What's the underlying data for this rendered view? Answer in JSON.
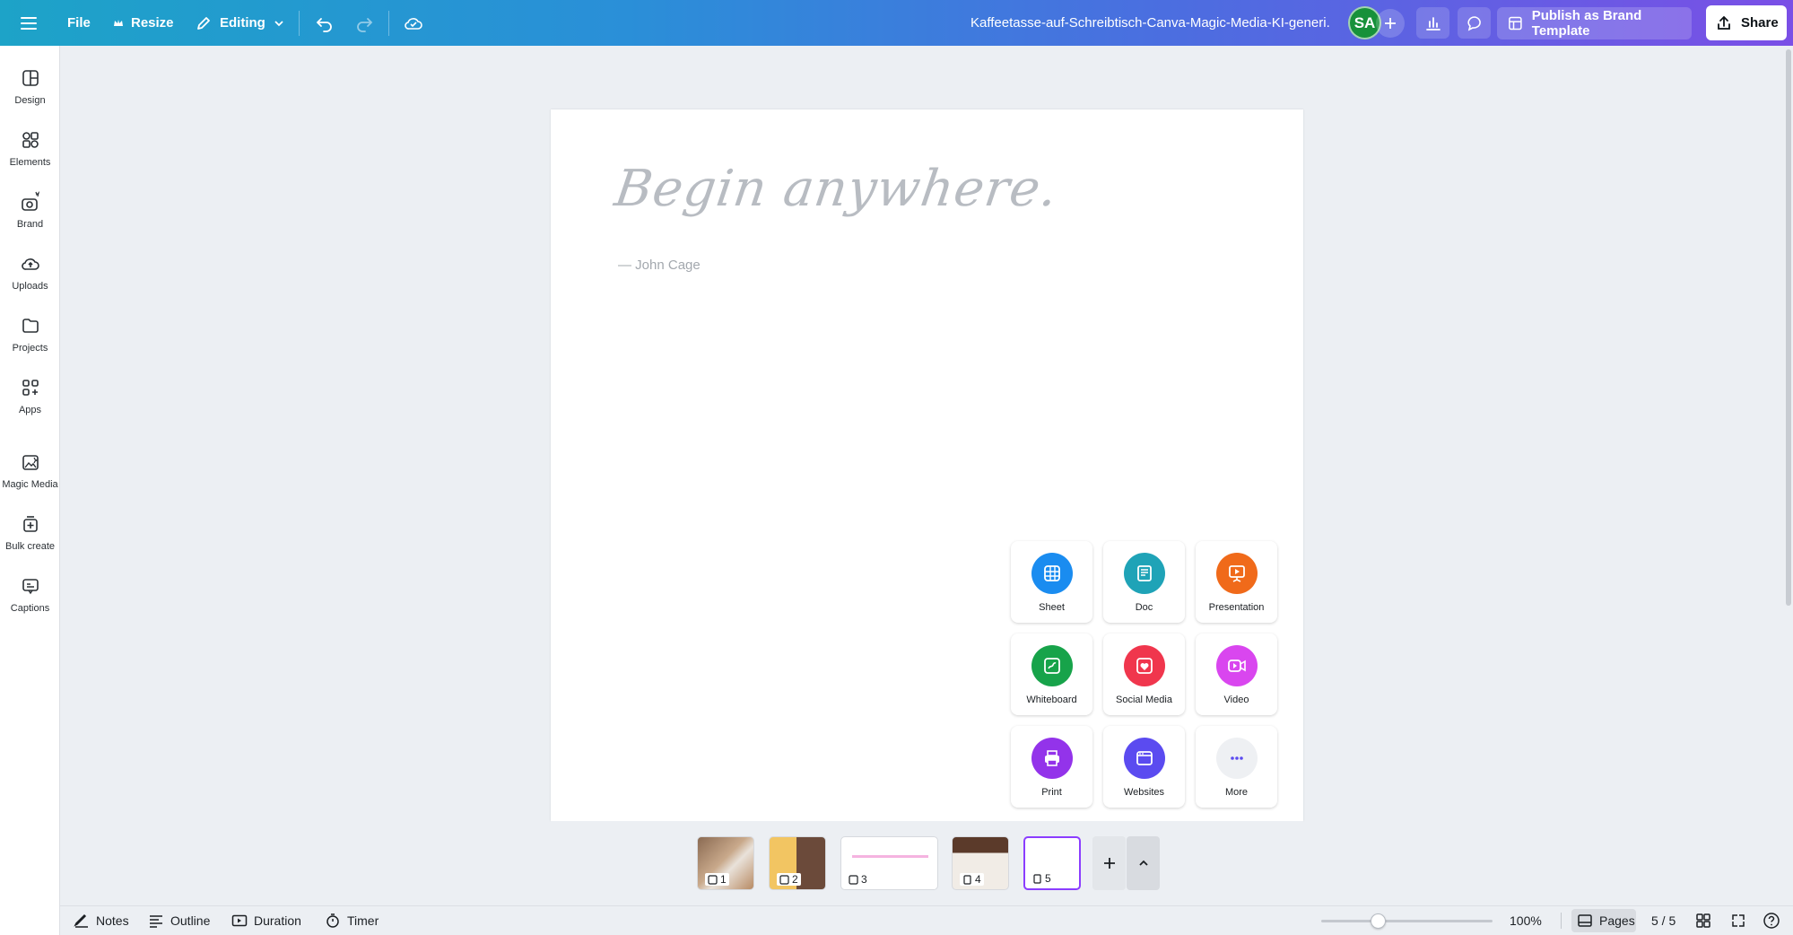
{
  "topbar": {
    "file_label": "File",
    "resize_label": "Resize",
    "editing_label": "Editing",
    "document_title": "Kaffeetasse-auf-Schreibtisch-Canva-Magic-Media-KI-generi...",
    "avatar_initials": "SA",
    "publish_label": "Publish as Brand Template",
    "share_label": "Share"
  },
  "sidebar": {
    "items": [
      {
        "label": "Design",
        "icon": "design-icon"
      },
      {
        "label": "Elements",
        "icon": "elements-icon"
      },
      {
        "label": "Brand",
        "icon": "brand-icon"
      },
      {
        "label": "Uploads",
        "icon": "uploads-icon"
      },
      {
        "label": "Projects",
        "icon": "projects-icon"
      },
      {
        "label": "Apps",
        "icon": "apps-icon"
      },
      {
        "label": "Magic Media",
        "icon": "magic-media-icon"
      },
      {
        "label": "Bulk create",
        "icon": "bulk-create-icon"
      },
      {
        "label": "Captions",
        "icon": "captions-icon"
      }
    ]
  },
  "canvas": {
    "quote": "Begin anywhere.",
    "author": "— John Cage"
  },
  "create_menu": {
    "items": [
      {
        "label": "Sheet",
        "color": "#1a8cf0"
      },
      {
        "label": "Doc",
        "color": "#1fa3b7"
      },
      {
        "label": "Presentation",
        "color": "#f06a1a"
      },
      {
        "label": "Whiteboard",
        "color": "#17a34a"
      },
      {
        "label": "Social Media",
        "color": "#f0364d"
      },
      {
        "label": "Video",
        "color": "#d946ef"
      },
      {
        "label": "Print",
        "color": "#9333ea"
      },
      {
        "label": "Websites",
        "color": "#5b4bf0"
      },
      {
        "label": "More",
        "color": "#eef0f3"
      }
    ]
  },
  "pages": {
    "thumbs": [
      "1",
      "2",
      "3",
      "4",
      "5"
    ],
    "active": "5"
  },
  "bottombar": {
    "notes_label": "Notes",
    "outline_label": "Outline",
    "duration_label": "Duration",
    "timer_label": "Timer",
    "zoom": "100%",
    "zoom_fraction": 0.33,
    "pages_label": "Pages",
    "page_count": "5 / 5"
  }
}
